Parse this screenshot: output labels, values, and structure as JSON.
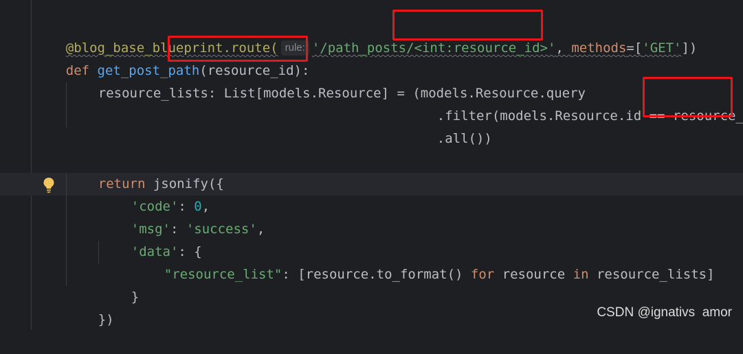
{
  "code": {
    "l1": {
      "decorator": "@blog_base_blueprint.route(",
      "hint": "rule:",
      "path_str": "'/path_posts/<int:resource_id>'",
      "comma": ", ",
      "kwarg": "methods",
      "eq": "=[",
      "get_str": "'GET'",
      "close": "])"
    },
    "l2": {
      "def_kw": "def",
      "fn_name": "get_post_path",
      "args": "(resource_id):"
    },
    "l3": {
      "text": "resource_lists: List[models.Resource] = (models.Resource.query"
    },
    "l4": {
      "text": ".filter(models.Resource.id == resource_id))"
    },
    "l5": {
      "text": ".all())"
    },
    "l6": {
      "return_kw": "return",
      "rest": " jsonify({"
    },
    "l7": {
      "key": "'code'",
      "colon": ": ",
      "num": "0",
      "comma": ","
    },
    "l8": {
      "key": "'msg'",
      "colon": ": ",
      "val": "'success'",
      "comma": ","
    },
    "l9": {
      "key": "'data'",
      "colon": ": {"
    },
    "l10": {
      "key": "\"resource_list\"",
      "colon": ": [resource.to_format() ",
      "for_kw": "for",
      "mid": " resource ",
      "in_kw": "in",
      "end": " resource_lists]"
    },
    "l11": {
      "text": "}"
    },
    "l12": {
      "text": "})"
    }
  },
  "watermark": "CSDN @ignativs  amor",
  "colors": {
    "background": "#1e1f22",
    "keyword": "#cf8e6d",
    "function": "#56a8f5",
    "string": "#6aab73",
    "number": "#2aacb8",
    "decorator": "#b3ae60",
    "highlight_box": "#e8161b"
  }
}
